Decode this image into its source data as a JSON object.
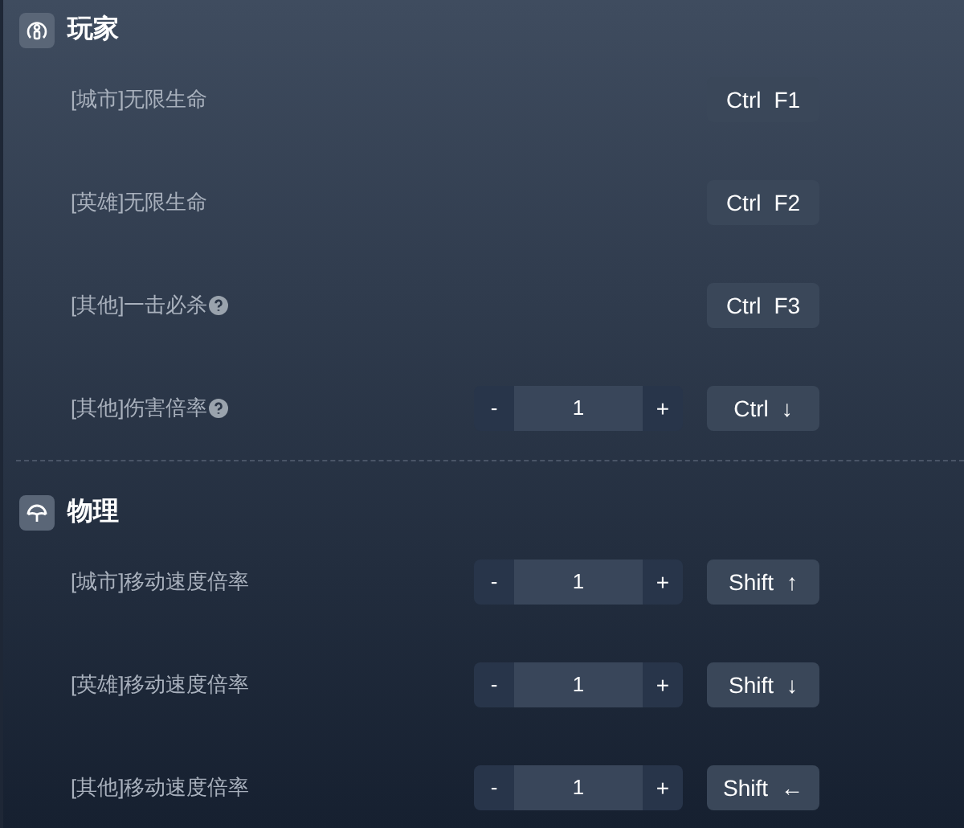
{
  "sections": [
    {
      "title": "玩家",
      "rows": [
        {
          "label": "[城市]无限生命",
          "help": false,
          "kind": "toggle",
          "keys": [
            "Ctrl",
            "F1"
          ]
        },
        {
          "label": "[英雄]无限生命",
          "help": false,
          "kind": "toggle",
          "keys": [
            "Ctrl",
            "F2"
          ]
        },
        {
          "label": "[其他]一击必杀",
          "help": true,
          "kind": "toggle",
          "keys": [
            "Ctrl",
            "F3"
          ]
        },
        {
          "label": "[其他]伤害倍率",
          "help": true,
          "kind": "stepper",
          "minus": "-",
          "value": "1",
          "plus": "+",
          "keys": [
            "Ctrl",
            "↓"
          ]
        }
      ]
    },
    {
      "title": "物理",
      "rows": [
        {
          "label": "[城市]移动速度倍率",
          "help": false,
          "kind": "stepper",
          "minus": "-",
          "value": "1",
          "plus": "+",
          "keys": [
            "Shift",
            "↑"
          ]
        },
        {
          "label": "[英雄]移动速度倍率",
          "help": false,
          "kind": "stepper",
          "minus": "-",
          "value": "1",
          "plus": "+",
          "keys": [
            "Shift",
            "↓"
          ]
        },
        {
          "label": "[其他]移动速度倍率",
          "help": false,
          "kind": "stepper",
          "minus": "-",
          "value": "1",
          "plus": "+",
          "keys": [
            "Shift",
            "←"
          ]
        }
      ]
    }
  ]
}
